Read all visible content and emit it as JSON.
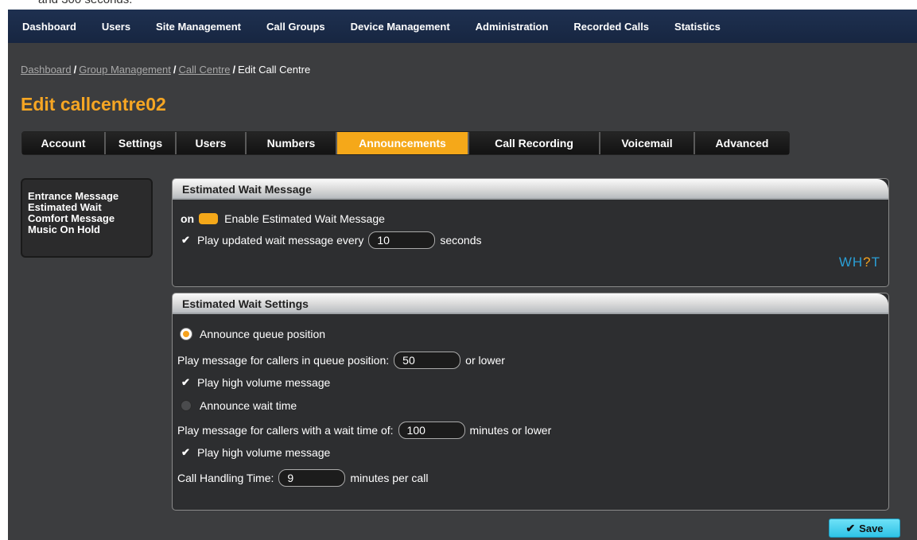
{
  "doc_fragment": "and 300 seconds.",
  "nav": [
    "Dashboard",
    "Users",
    "Site Management",
    "Call Groups",
    "Device Management",
    "Administration",
    "Recorded Calls",
    "Statistics"
  ],
  "breadcrumb": {
    "links": [
      "Dashboard",
      "Group Management",
      "Call Centre"
    ],
    "current": "Edit Call Centre",
    "separator": "/"
  },
  "page_title": "Edit callcentre02",
  "tabs": [
    "Account",
    "Settings",
    "Users",
    "Numbers",
    "Announcements",
    "Call Recording",
    "Voicemail",
    "Advanced"
  ],
  "active_tab": "Announcements",
  "left_menu": [
    "Entrance Message",
    "Estimated Wait",
    "Comfort Message",
    "Music On Hold"
  ],
  "wait_message": {
    "title": "Estimated Wait Message",
    "toggle_state": "on",
    "enable_label": "Enable Estimated Wait Message",
    "play_label": "Play updated wait message every",
    "play_value": "10",
    "play_unit": "seconds",
    "logo": {
      "left": "WH",
      "q": "?",
      "right": "T"
    }
  },
  "wait_settings": {
    "title": "Estimated Wait Settings",
    "announce_queue": "Announce queue position",
    "queue_label": "Play message for callers in queue position:",
    "queue_value": "50",
    "queue_suffix": "or lower",
    "high_volume_1": "Play high volume message",
    "announce_wait": "Announce wait time",
    "wait_label": "Play message for callers with a wait time of:",
    "wait_value": "100",
    "wait_suffix": "minutes or lower",
    "high_volume_2": "Play high volume message",
    "handling_label": "Call Handling Time:",
    "handling_value": "9",
    "handling_suffix": "minutes per call"
  },
  "save_label": "Save",
  "colors": {
    "accent": "#f5a819",
    "nav_bg": "#1e3050",
    "save": "#2fc3e6"
  }
}
